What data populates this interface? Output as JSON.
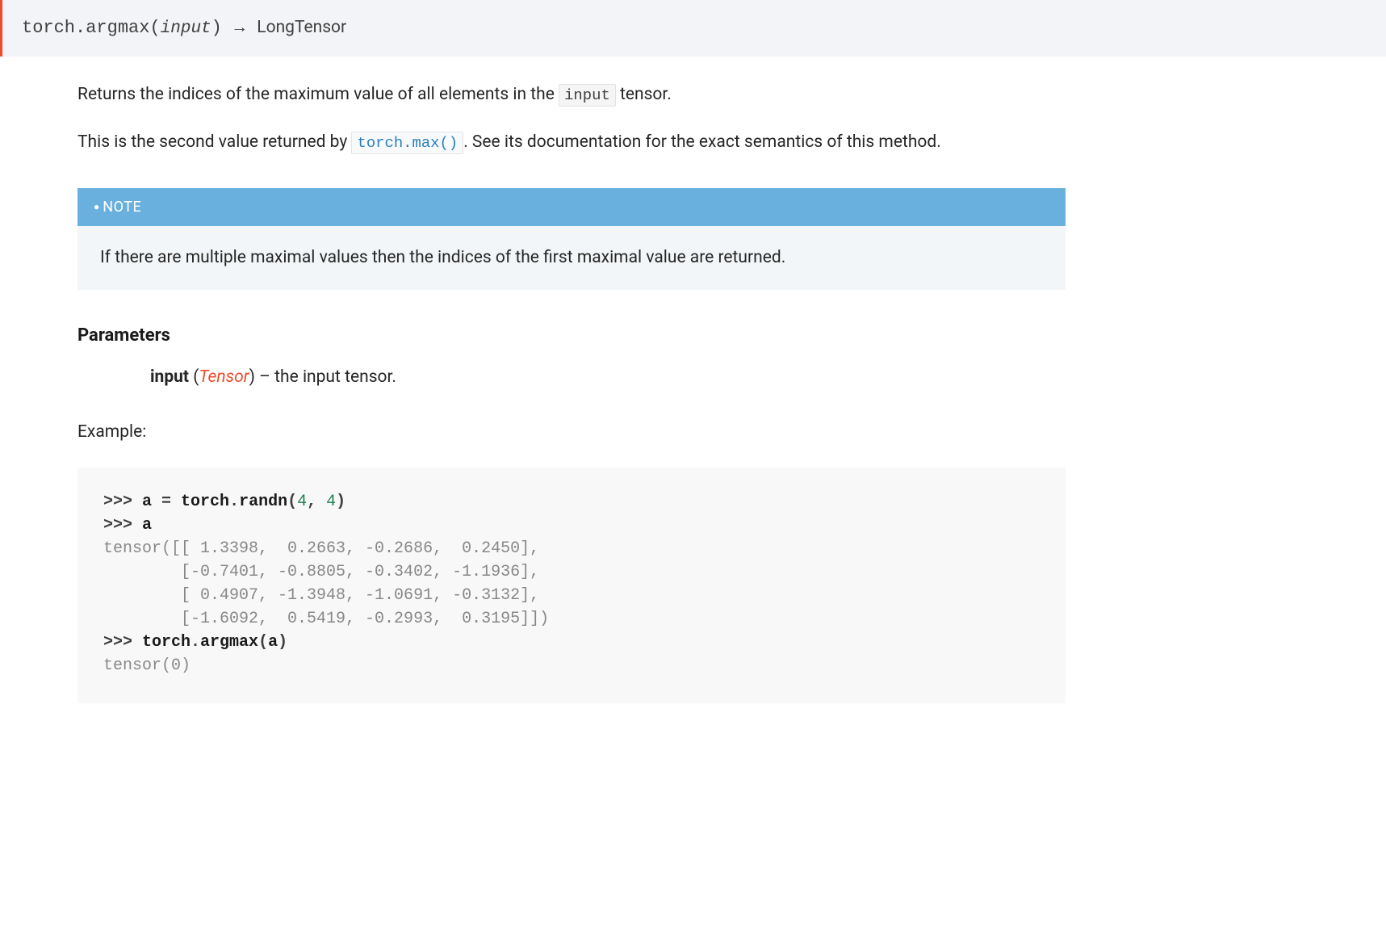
{
  "signature": {
    "qualname": "torch.argmax",
    "paren_open": "(",
    "param": "input",
    "paren_close": ")",
    "arrow": "→",
    "return_type": "LongTensor"
  },
  "description": {
    "p1_pre": "Returns the indices of the maximum value of all elements in the ",
    "p1_code": "input",
    "p1_post": " tensor.",
    "p2_pre": "This is the second value returned by ",
    "p2_link": "torch.max()",
    "p2_post": ". See its documentation for the exact semantics of this method."
  },
  "note": {
    "title": "NOTE",
    "body": "If there are multiple maximal values then the indices of the first maximal value are returned."
  },
  "parameters": {
    "heading": "Parameters",
    "param_name": "input",
    "param_type_open": " (",
    "param_type": "Tensor",
    "param_type_close": ") – ",
    "param_desc": "the input tensor."
  },
  "example": {
    "label": "Example:",
    "line1_prompt": ">>> ",
    "line1_var": "a",
    "line1_eq": " = ",
    "line1_call_mod": "torch",
    "line1_call_dot": ".",
    "line1_call_fn": "randn",
    "line1_call_open": "(",
    "line1_arg1": "4",
    "line1_comma": ", ",
    "line1_arg2": "4",
    "line1_call_close": ")",
    "line2_prompt": ">>> ",
    "line2_var": "a",
    "out_block": "tensor([[ 1.3398,  0.2663, -0.2686,  0.2450],\n        [-0.7401, -0.8805, -0.3402, -1.1936],\n        [ 0.4907, -1.3948, -1.0691, -0.3132],\n        [-1.6092,  0.5419, -0.2993,  0.3195]])",
    "line3_prompt": ">>> ",
    "line3_call_mod": "torch",
    "line3_call_dot": ".",
    "line3_call_fn": "argmax",
    "line3_call_open": "(",
    "line3_arg": "a",
    "line3_call_close": ")",
    "out_final": "tensor(0)"
  }
}
